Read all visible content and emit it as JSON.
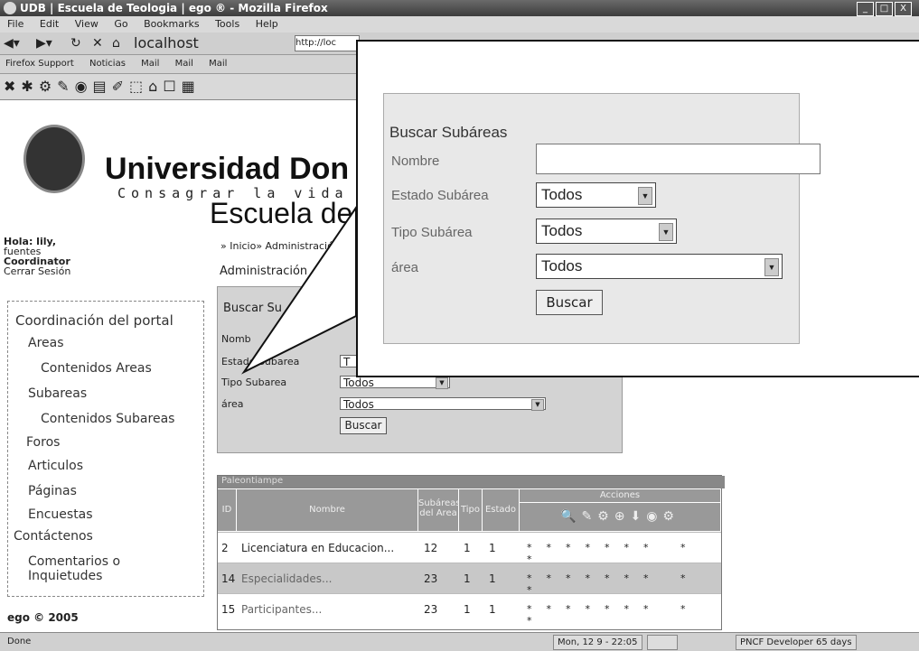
{
  "window": {
    "title": "UDB | Escuela de Teologia | ego ® - Mozilla Firefox"
  },
  "menu": [
    "File",
    "Edit",
    "View",
    "Go",
    "Bookmarks",
    "Tools",
    "Help"
  ],
  "nav": {
    "address": "localhost",
    "url_short": "http://loc"
  },
  "bookmarks": [
    "Firefox Support",
    "Noticias",
    "Mail",
    "Mail",
    "Mail"
  ],
  "site": {
    "brand": "Universidad Don",
    "motto": "Consagrar la vida a la",
    "school": "Escuela de T"
  },
  "user": {
    "greeting": "Hola: lily,",
    "lastname": "fuentes",
    "role": "Coordinator",
    "logout": "Cerrar Sesión"
  },
  "breadcrumb": "» Inicio» Administració",
  "admin_title": "Administración",
  "sidebar": {
    "items": [
      {
        "label": "Coordinación del portal"
      },
      {
        "label": "Areas"
      },
      {
        "label": "Contenidos Areas"
      },
      {
        "label": "Subareas"
      },
      {
        "label": "Contenidos Subareas"
      },
      {
        "label": "Foros"
      },
      {
        "label": "Articulos"
      },
      {
        "label": "Páginas"
      },
      {
        "label": "Encuestas"
      },
      {
        "label": "Contáctenos"
      },
      {
        "label": "Comentarios o Inquietudes"
      }
    ]
  },
  "footer": "ego © 2005",
  "search": {
    "title": "Buscar Subáreas",
    "title_small": "Buscar Su",
    "name_label": "Nombre",
    "name_small": "Nomb",
    "name_value": "",
    "estado_label": "Estado Subárea",
    "estado_small": "Estado Subarea",
    "estado_value": "Todos",
    "estado_value_small": "T",
    "tipo_label": "Tipo Subárea",
    "tipo_small": "Tipo Subarea",
    "tipo_value": "Todos",
    "area_label": "área",
    "area_value": "Todos",
    "button": "Buscar"
  },
  "table": {
    "caption": "Paleontiampe",
    "headers": {
      "id": "ID",
      "name": "Nombre",
      "count": "Subáreas del Area",
      "tipo": "Tipo",
      "estado": "Estado",
      "acciones": "Acciones"
    },
    "rows": [
      {
        "id": "2",
        "name": "Licenciatura en Educacion...",
        "count": "12",
        "tipo": "1",
        "estado": "1"
      },
      {
        "id": "14",
        "name": "Especialidades...",
        "count": "23",
        "tipo": "1",
        "estado": "1"
      },
      {
        "id": "15",
        "name": "Participantes...",
        "count": "23",
        "tipo": "1",
        "estado": "1"
      }
    ]
  },
  "status": {
    "left": "Done",
    "date": "Mon, 12 9 - 22:05",
    "extra": "PNCF Developer 65 days"
  },
  "colors": {
    "table_header": "#999999",
    "form_bg": "#d3d3d3",
    "callout_bg": "#e8e8e8"
  }
}
